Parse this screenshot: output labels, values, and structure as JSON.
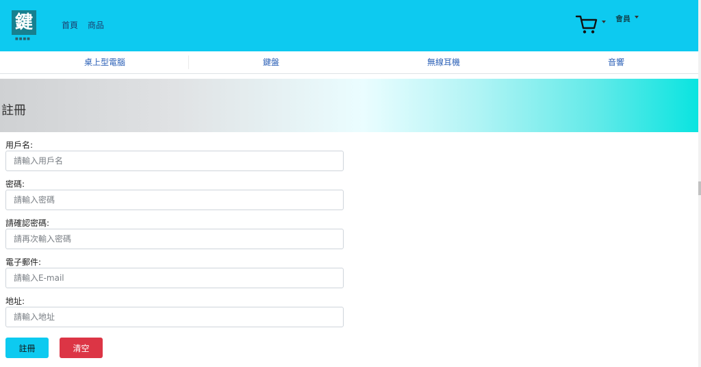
{
  "brand": {
    "logo_char": "鍵",
    "logo_sub": "■■■■"
  },
  "nav": {
    "links": [
      {
        "label": "首頁"
      },
      {
        "label": "商品"
      }
    ],
    "cart_icon": "shopping-cart-icon",
    "member_label": "會員"
  },
  "categories": [
    {
      "label": "桌上型電腦"
    },
    {
      "label": "鍵盤"
    },
    {
      "label": "無線耳機"
    },
    {
      "label": "音響"
    }
  ],
  "banner": {
    "title": "註冊"
  },
  "form": {
    "fields": [
      {
        "label": "用戶名:",
        "placeholder": "請輸入用戶名",
        "value": ""
      },
      {
        "label": "密碼:",
        "placeholder": "請輸入密碼",
        "value": ""
      },
      {
        "label": "請確認密碼:",
        "placeholder": "請再次輸入密碼",
        "value": ""
      },
      {
        "label": "電子郵件:",
        "placeholder": "請輸入E-mail",
        "value": ""
      },
      {
        "label": "地址:",
        "placeholder": "請輸入地址",
        "value": ""
      }
    ],
    "submit_label": "註冊",
    "clear_label": "清空"
  },
  "colors": {
    "navbar": "#0dcaf0",
    "logo_bg": "#17808f",
    "category_link": "#2f63b8",
    "register_button": "#0dcaf0",
    "clear_button": "#dc3545"
  }
}
